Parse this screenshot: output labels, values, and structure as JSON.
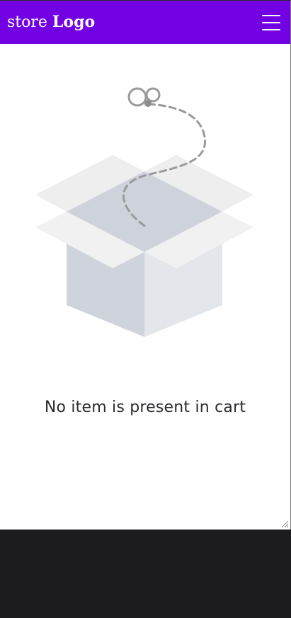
{
  "header": {
    "brand_regular": "store",
    "brand_bold": "Logo",
    "menu_icon": "hamburger-menu-icon",
    "background_color": "#7302e3"
  },
  "cart": {
    "empty_message": "No item is present in cart",
    "illustration": "empty-box-icon"
  },
  "colors": {
    "background": "#ffffff",
    "text": "#2b2b30",
    "box_side": "#ced3dc",
    "box_front": "#e3e6ea",
    "box_flap": "#f0f0f0",
    "dash_path": "#9a9a9a"
  }
}
